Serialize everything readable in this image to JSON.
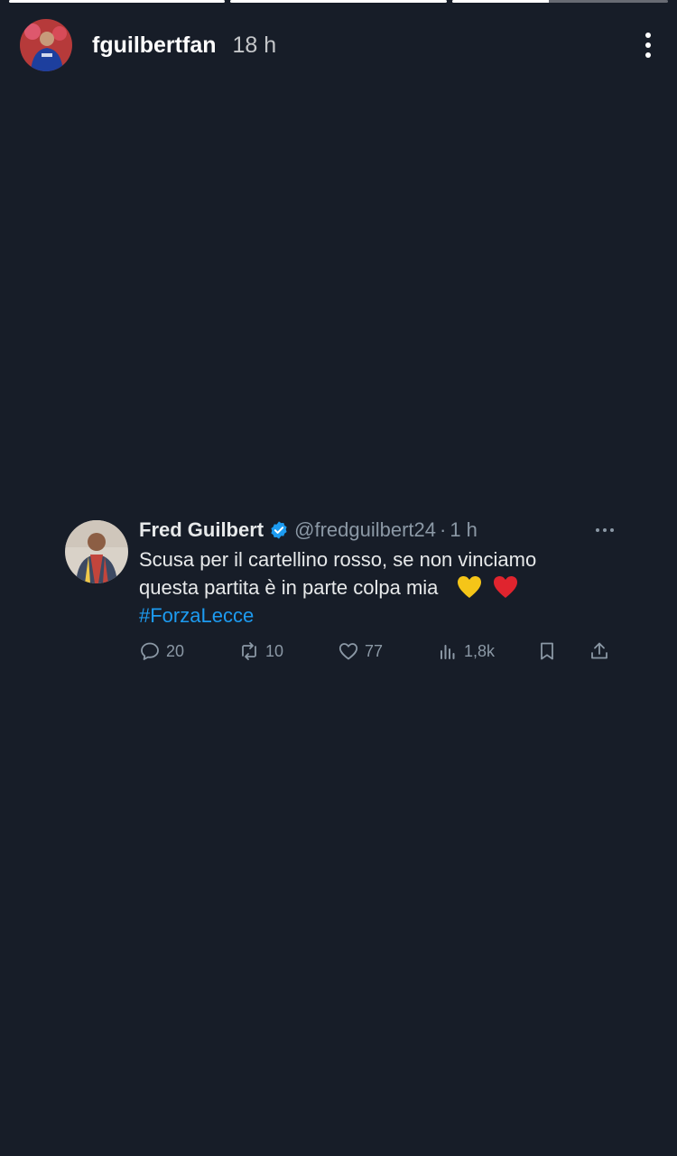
{
  "story": {
    "progress": [
      1.0,
      1.0,
      0.45
    ],
    "username": "fguilbertfan",
    "time": "18 h"
  },
  "tweet": {
    "name": "Fred Guilbert",
    "handle": "@fredguilbert24",
    "separator": "·",
    "age": "1 h",
    "text_line1": "Scusa per il cartellino rosso, se non vinciamo",
    "text_line2": "questa partita è in parte colpa mia",
    "hashtag": "#ForzaLecce",
    "emoji_1": "yellow-heart-icon",
    "emoji_2": "red-heart-icon",
    "actions": {
      "replies": "20",
      "retweets": "10",
      "likes": "77",
      "views": "1,8k"
    }
  },
  "colors": {
    "background": "#171d28",
    "accent": "#1d9bf0",
    "muted": "#8b98a5"
  }
}
